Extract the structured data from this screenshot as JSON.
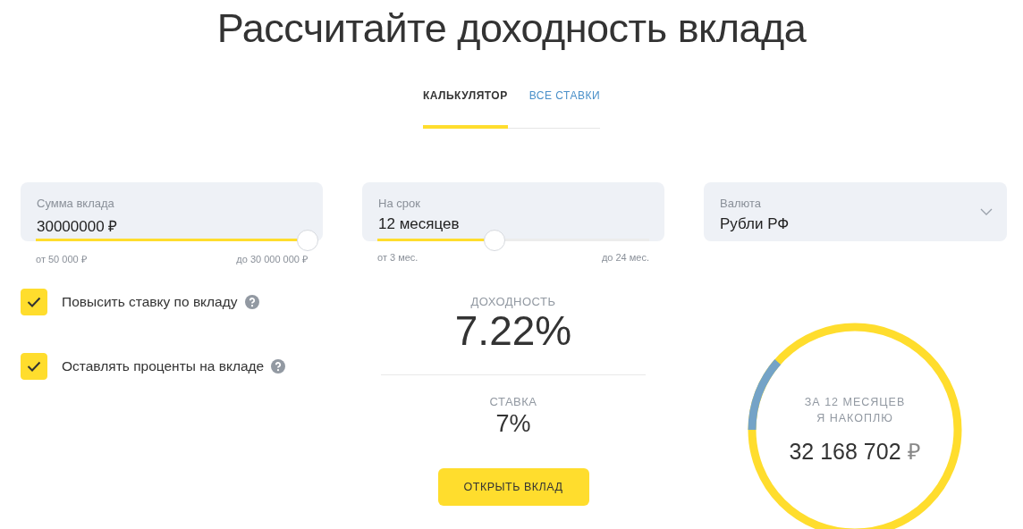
{
  "title": "Рассчитайте доходность вклада",
  "tabs": [
    {
      "label": "КАЛЬКУЛЯТОР",
      "selected": true
    },
    {
      "label": "ВСЕ СТАВКИ",
      "selected": false
    }
  ],
  "amount": {
    "label": "Сумма вклада",
    "value": "30000000 ₽",
    "level": 1,
    "min": "от 50 000 ₽",
    "max": "до 30 000 000 ₽"
  },
  "term": {
    "label": "На срок",
    "value": "12 месяцев",
    "level": 0.43,
    "min": "от 3 мес.",
    "max": "до 24 мес."
  },
  "currency": {
    "label": "Валюта",
    "value": "Рубли РФ"
  },
  "options": [
    {
      "label": "Повысить ставку по вкладу",
      "checked": true
    },
    {
      "label": "Оставлять проценты на вкладе",
      "checked": true
    }
  ],
  "yield": {
    "label": "ДОХОДНОСТЬ",
    "value": "7.22%"
  },
  "rate": {
    "label": "СТАВКА",
    "value": "7%"
  },
  "open_button": "ОТКРЫТЬ ВКЛАД",
  "savings": {
    "caption_lines": [
      "ЗА 12 МЕСЯЦЕВ",
      "Я НАКОПЛЮ"
    ],
    "amount": "32 168 702",
    "currency": "₽",
    "level": 0.115
  }
}
